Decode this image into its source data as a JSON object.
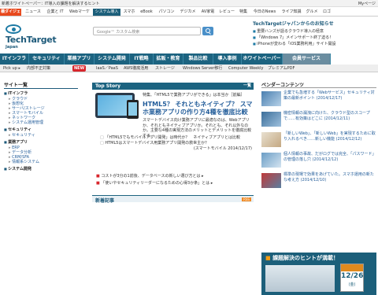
{
  "topbar": {
    "title": "新着ホワイトペーパー：IT導入の課題を解決するヒント",
    "mypage": "Myページ"
  },
  "nav1": [
    "橋ダイジェスト",
    "ニュース",
    "企業と IT",
    "Webマーケ",
    "システム導入",
    "スマホ",
    "eBook",
    "パソコン",
    "デジカメ",
    "AV家電",
    "レビュー",
    "特集",
    "今日のNews",
    "ライフ知識",
    "グルメ",
    "ロゴ"
  ],
  "search": {
    "placeholder": "Google™ カスタム検索"
  },
  "brand": {
    "name": "TechTarget",
    "sub": "Japan"
  },
  "news": {
    "title": "TechTargetジャパンからのお知らせ",
    "items": [
      "重要ハンズが語るクラウド導入の極意",
      "「Windows 7」メインサポート終了迫る！",
      "iPhoneが変わる「iOS業務利用」サイト開設"
    ]
  },
  "nav2": [
    "ITインフラ",
    "セキュリティ",
    "業務アプリ",
    "システム開発",
    "IT戦略",
    "拡販・教育",
    "製品比較",
    "導入事例",
    "ホワイトペーパー",
    "会員サービス"
  ],
  "subnav": {
    "pickup": "Pick up ▸",
    "items": [
      "内部不正対策",
      "IaaS／PaaS",
      "AWS徹底活用",
      "ストレージ",
      "Windows Server移行",
      "Computer Weekly",
      "プレミアムPDF"
    ],
    "new_badge": "NEW"
  },
  "sidebar": {
    "title": "サイト一覧",
    "categories": [
      {
        "name": "ITインフラ",
        "items": [
          "クラウド",
          "仮想化",
          "サーバ/ストレージ",
          "スマートモバイル",
          "ネットワーク",
          "システム運用管理"
        ]
      },
      {
        "name": "セキュリティ",
        "items": [
          "セキュリティ"
        ]
      },
      {
        "name": "業務アプリ",
        "items": [
          "ERP",
          "データ分析",
          "CRM/SFA",
          "情報系システム"
        ]
      },
      {
        "name": "システム開発",
        "items": []
      }
    ]
  },
  "story": {
    "title": "Top Story",
    "more": "一覧",
    "kicker": "特集、「HTML5で業務アプリができる」は本当か［前編］",
    "headline": "HTML5？ それともネイティブ？ スマホ業務アプリの作り方4種を徹底比較",
    "desc": "スマートデバイス向け業務アプリに最適なのは、Webアプリか、それともネイティブアプリか。それとも、それ以外なのか。主要な4種の実現方法のメリットとデメリットを徹底比較する。",
    "related": [
      "「HTML5でもモバイルアプリ開発」は時代か？　ネイティブアプリとは比較",
      "HTML5はスマートデバイス用業務アプリ開発の救世主か？"
    ],
    "byline": "(スマートモバイル 2014/12/17)"
  },
  "more_links": [
    "コストが3分の1前後、データベースの新しい選び方とは ▸",
    "「使いやセキュリティリーダーになるための心得3か条」とは ▸"
  ],
  "latest": {
    "title": "新着記事",
    "rss": "RSS"
  },
  "right": {
    "title": "ベンダーコンテンツ",
    "items": [
      {
        "text": "企業でも急増する「Webサービス」セキュリティ対策の最新ボイント (2014/12/17)"
      },
      {
        "text": "機密情報の漏洩に向けた、クラウド型のスコープで……有効策はどこに (2014/12/11)"
      },
      {
        "text": "「新しいWeb」、「新しいWeb」を実現するために取り入れるべき……新しい機能 (2014/12/12)"
      },
      {
        "text": "個人情報の事故、だがログでは完全、「パスワード」の管理の落し穴 (2014/12/12)"
      },
      {
        "text": "標準の現場で効果をあげていた。スマホ運用の新たな考え方 (2014/12/10)"
      }
    ]
  },
  "banner": {
    "title": "課題解決のヒントが満載！",
    "date": "12/26",
    "dow": "(金)"
  }
}
